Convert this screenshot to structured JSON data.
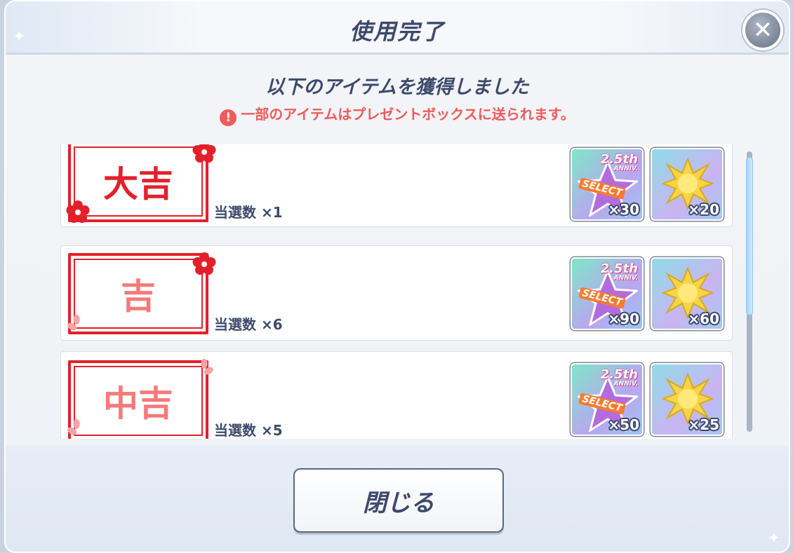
{
  "dialog": {
    "title": "使用完了",
    "headline": "以下のアイテムを獲得しました",
    "notice": "一部のアイテムはプレゼントボックスに送られます。",
    "notice_icon": "!",
    "close_icon": "✕",
    "close_button_label": "閉じる"
  },
  "results": [
    {
      "fortune": "大吉",
      "fortune_color": "#e3202a",
      "count_label": "当選数 ×1",
      "items": [
        {
          "icon": "select-star-ticket-icon",
          "anniv_num": "2.5th",
          "anniv_text": "ANNIV.",
          "tag": "SELECT",
          "qty": "×30"
        },
        {
          "icon": "gold-crystal-icon",
          "qty": "×20"
        }
      ]
    },
    {
      "fortune": "吉",
      "fortune_color": "#f47a7a",
      "count_label": "当選数 ×6",
      "items": [
        {
          "icon": "select-star-ticket-icon",
          "anniv_num": "2.5th",
          "anniv_text": "ANNIV.",
          "tag": "SELECT",
          "qty": "×90"
        },
        {
          "icon": "gold-crystal-icon",
          "qty": "×60"
        }
      ]
    },
    {
      "fortune": "中吉",
      "fortune_color": "#f47a7a",
      "count_label": "当選数 ×5",
      "items": [
        {
          "icon": "select-star-ticket-icon",
          "anniv_num": "2.5th",
          "anniv_text": "ANNIV.",
          "tag": "SELECT",
          "qty": "×50"
        },
        {
          "icon": "gold-crystal-icon",
          "qty": "×25"
        }
      ]
    }
  ],
  "colors": {
    "accent_text": "#3d4a6b",
    "notice": "#f05a5a",
    "ticket_border": "#e3202a"
  }
}
